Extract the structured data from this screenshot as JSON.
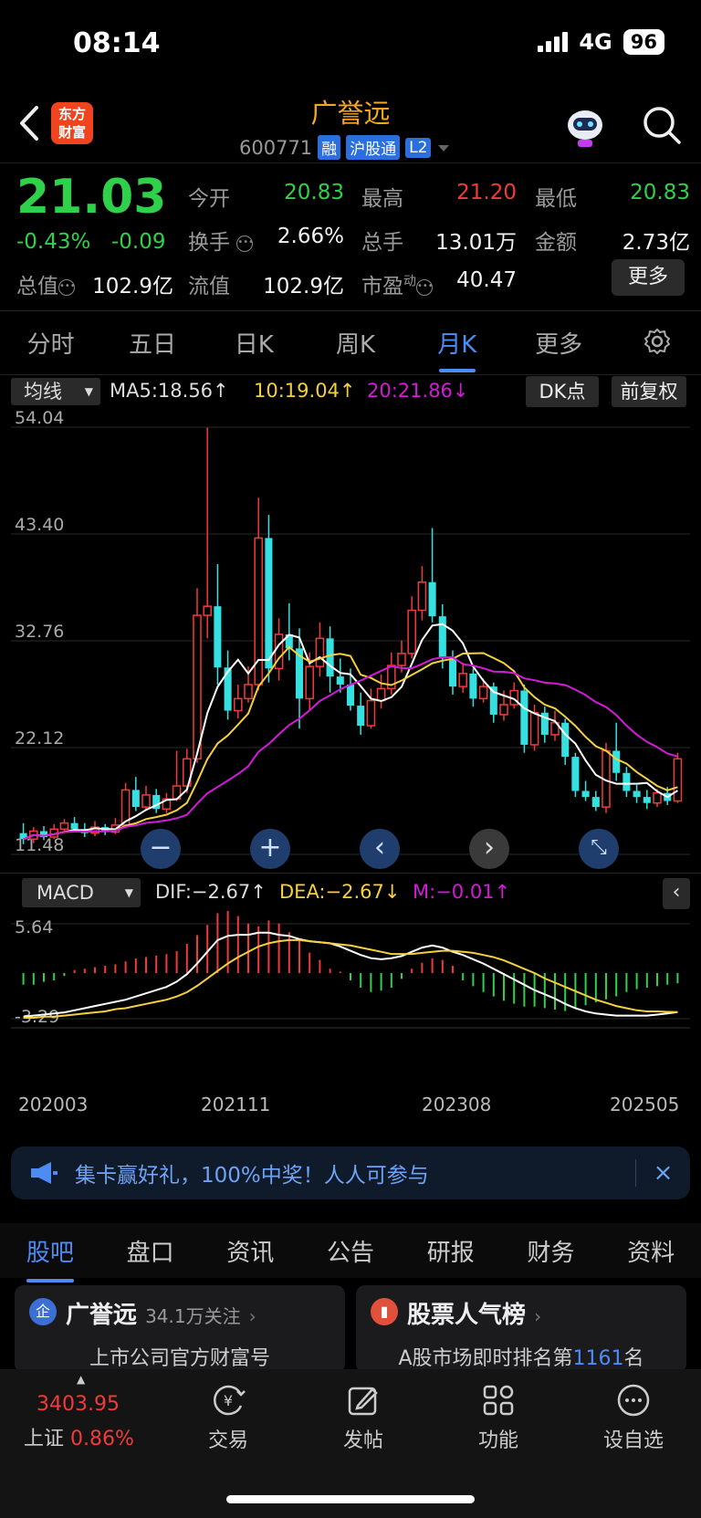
{
  "status": {
    "time": "08:14",
    "network": "4G",
    "battery": "96"
  },
  "header": {
    "logo_line1": "东方",
    "logo_line2": "财富",
    "name": "广誉远",
    "code": "600771",
    "tags": [
      "融",
      "沪股通",
      "L2"
    ]
  },
  "quote": {
    "price": "21.03",
    "change_pct": "-0.43%",
    "change_val": "-0.09",
    "open_label": "今开",
    "open": "20.83",
    "high_label": "最高",
    "high": "21.20",
    "low_label": "最低",
    "low": "20.83",
    "turnover_label": "换手",
    "turnover": "2.66%",
    "volume_label": "总手",
    "volume": "13.01万",
    "amount_label": "金额",
    "amount": "2.73亿",
    "mktcap_label": "总值",
    "mktcap": "102.9亿",
    "float_label": "流值",
    "float": "102.9亿",
    "pe_label": "市盈",
    "pe_sup": "动",
    "pe": "40.47",
    "more_label": "更多"
  },
  "period_tabs": [
    "分时",
    "五日",
    "日K",
    "周K",
    "月K",
    "更多"
  ],
  "active_period": "月K",
  "ma": {
    "select": "均线",
    "ma5": "MA5:18.56↑",
    "ma10": "10:19.04↑",
    "ma20": "20:21.86↓",
    "dk": "DK点",
    "adjust": "前复权"
  },
  "chart_data": [
    {
      "type": "candlestick",
      "title": "",
      "y_ticks": [
        "54.04",
        "43.40",
        "32.76",
        "22.12",
        "11.48"
      ],
      "ylim": [
        11.48,
        54.04
      ],
      "series": [
        {
          "name": "MA5",
          "color": "#ffffff",
          "last": 18.56
        },
        {
          "name": "10",
          "color": "#f4d03f",
          "last": 19.04
        },
        {
          "name": "20",
          "color": "#d21bd6",
          "last": 21.86
        }
      ],
      "x_ticks": [
        "202003",
        "202111",
        "202308",
        "202505"
      ],
      "candles": [
        [
          13.6,
          13.0,
          14.6,
          12.5
        ],
        [
          13.0,
          13.8,
          14.2,
          12.6
        ],
        [
          13.8,
          13.2,
          14.3,
          12.9
        ],
        [
          13.2,
          14.0,
          14.5,
          13.0
        ],
        [
          14.0,
          14.6,
          15.0,
          13.6
        ],
        [
          14.6,
          14.0,
          15.2,
          13.8
        ],
        [
          14.0,
          13.6,
          14.6,
          13.2
        ],
        [
          13.6,
          14.2,
          14.8,
          13.3
        ],
        [
          14.2,
          13.7,
          14.5,
          13.4
        ],
        [
          13.7,
          14.4,
          15.1,
          13.5
        ],
        [
          14.4,
          17.9,
          18.6,
          14.1
        ],
        [
          17.9,
          16.2,
          19.2,
          15.8
        ],
        [
          16.2,
          17.4,
          18.3,
          15.8
        ],
        [
          17.4,
          16.0,
          18.0,
          15.6
        ],
        [
          16.0,
          17.0,
          17.6,
          15.6
        ],
        [
          17.0,
          18.3,
          21.8,
          16.8
        ],
        [
          18.3,
          21.0,
          22.0,
          17.6
        ],
        [
          21.0,
          35.3,
          38.0,
          20.6
        ],
        [
          35.3,
          36.2,
          54.0,
          33.0
        ],
        [
          36.2,
          30.1,
          40.4,
          28.4
        ],
        [
          30.1,
          25.8,
          31.8,
          24.9
        ],
        [
          25.8,
          27.0,
          28.4,
          25.0
        ],
        [
          27.0,
          28.4,
          30.2,
          26.6
        ],
        [
          28.4,
          43.0,
          47.0,
          27.8
        ],
        [
          43.0,
          30.0,
          45.3,
          28.6
        ],
        [
          30.0,
          33.4,
          35.0,
          28.8
        ],
        [
          33.4,
          32.0,
          36.5,
          30.8
        ],
        [
          32.0,
          27.0,
          34.0,
          24.0
        ],
        [
          27.0,
          30.2,
          31.6,
          25.8
        ],
        [
          30.2,
          33.0,
          34.6,
          29.2
        ],
        [
          33.0,
          29.2,
          34.2,
          27.6
        ],
        [
          29.2,
          28.4,
          31.0,
          27.6
        ],
        [
          28.4,
          26.3,
          30.0,
          25.8
        ],
        [
          26.3,
          24.3,
          27.6,
          23.4
        ],
        [
          24.3,
          26.8,
          28.0,
          24.0
        ],
        [
          26.8,
          28.0,
          29.4,
          26.0
        ],
        [
          28.0,
          30.3,
          31.6,
          27.4
        ],
        [
          30.3,
          31.5,
          32.8,
          29.6
        ],
        [
          31.5,
          35.8,
          37.2,
          31.0
        ],
        [
          35.8,
          38.6,
          40.2,
          34.8
        ],
        [
          38.6,
          35.2,
          44.0,
          34.6
        ],
        [
          35.2,
          31.0,
          36.4,
          30.0
        ],
        [
          31.0,
          28.2,
          31.8,
          27.4
        ],
        [
          28.2,
          29.5,
          30.6,
          27.6
        ],
        [
          29.5,
          27.0,
          30.0,
          26.2
        ],
        [
          27.0,
          28.2,
          29.0,
          26.6
        ],
        [
          28.2,
          25.4,
          28.6,
          24.6
        ],
        [
          25.4,
          26.4,
          27.8,
          24.8
        ],
        [
          26.4,
          27.8,
          28.6,
          26.0
        ],
        [
          27.8,
          22.4,
          28.4,
          21.6
        ],
        [
          22.4,
          25.6,
          26.4,
          21.8
        ],
        [
          25.6,
          23.4,
          26.2,
          22.6
        ],
        [
          23.4,
          24.6,
          25.8,
          22.8
        ],
        [
          24.6,
          21.2,
          25.0,
          20.4
        ],
        [
          21.2,
          17.8,
          21.6,
          17.2
        ],
        [
          17.8,
          17.2,
          18.8,
          16.8
        ],
        [
          17.2,
          16.2,
          17.8,
          15.8
        ],
        [
          16.2,
          21.8,
          22.6,
          15.6
        ],
        [
          21.8,
          19.6,
          24.6,
          18.8
        ],
        [
          19.6,
          17.8,
          20.2,
          17.2
        ],
        [
          17.8,
          17.2,
          18.4,
          16.6
        ],
        [
          17.2,
          16.6,
          17.9,
          16.0
        ],
        [
          16.6,
          17.6,
          18.0,
          16.2
        ],
        [
          17.6,
          16.8,
          18.2,
          16.4
        ],
        [
          16.8,
          21.0,
          21.6,
          16.6
        ]
      ]
    },
    {
      "type": "bar",
      "title": "",
      "y_ticks": [
        "5.64",
        "-3.29"
      ],
      "ylim": [
        -3.29,
        5.64
      ],
      "series": [
        {
          "name": "DIF",
          "color": "#ffffff",
          "last": -2.67
        },
        {
          "name": "DEA",
          "color": "#f4d03f",
          "last": -2.67
        },
        {
          "name": "M",
          "color": "#d21bd6",
          "last": -0.01
        }
      ],
      "macd_bars": [
        -0.8,
        -0.8,
        -0.6,
        -0.5,
        -0.2,
        0.2,
        0.3,
        0.4,
        0.5,
        0.6,
        0.8,
        1.0,
        1.1,
        1.2,
        1.3,
        1.5,
        2.0,
        2.6,
        3.3,
        4.1,
        4.6,
        3.9,
        3.4,
        3.2,
        3.6,
        3.4,
        2.8,
        2.2,
        1.4,
        0.9,
        0.3,
        0.1,
        -0.5,
        -1.0,
        -1.3,
        -1.2,
        -1.0,
        -0.4,
        0.3,
        0.7,
        1.0,
        0.9,
        0.5,
        -0.5,
        -0.9,
        -1.3,
        -1.6,
        -1.9,
        -2.1,
        -2.3,
        -2.3,
        -2.4,
        -2.5,
        -2.6,
        -2.4,
        -2.2,
        -2.0,
        -1.8,
        -1.6,
        -1.3,
        -1.1,
        -1.0,
        -0.9,
        -0.8,
        -0.7
      ],
      "dif": [
        -3.1,
        -3.0,
        -2.9,
        -2.8,
        -2.7,
        -2.5,
        -2.3,
        -2.1,
        -1.9,
        -1.7,
        -1.5,
        -1.2,
        -0.9,
        -0.6,
        -0.3,
        0.2,
        0.9,
        1.9,
        3.0,
        4.1,
        4.5,
        4.6,
        4.6,
        4.8,
        4.8,
        4.6,
        4.5,
        4.2,
        4.0,
        3.9,
        3.8,
        3.5,
        3.1,
        2.7,
        2.4,
        2.3,
        2.4,
        2.6,
        3.0,
        3.4,
        3.6,
        3.4,
        3.0,
        2.7,
        2.3,
        1.9,
        1.4,
        0.9,
        0.4,
        -0.1,
        -0.6,
        -1.0,
        -1.4,
        -1.9,
        -2.3,
        -2.6,
        -2.8,
        -2.9,
        -3.0,
        -3.0,
        -3.0,
        -3.0,
        -2.9,
        -2.8,
        -2.67
      ],
      "dea": [
        -3.2,
        -3.2,
        -3.1,
        -3.1,
        -3.0,
        -2.9,
        -2.8,
        -2.7,
        -2.6,
        -2.4,
        -2.3,
        -2.1,
        -1.9,
        -1.7,
        -1.5,
        -1.2,
        -0.8,
        -0.2,
        0.5,
        1.2,
        1.9,
        2.5,
        3.0,
        3.5,
        3.8,
        4.0,
        4.1,
        4.1,
        4.0,
        3.9,
        3.8,
        3.7,
        3.6,
        3.4,
        3.2,
        3.0,
        2.8,
        2.8,
        2.8,
        2.9,
        3.0,
        3.1,
        3.1,
        3.0,
        2.9,
        2.7,
        2.5,
        2.2,
        1.8,
        1.4,
        1.0,
        0.5,
        0.1,
        -0.3,
        -0.7,
        -1.1,
        -1.5,
        -1.8,
        -2.1,
        -2.3,
        -2.5,
        -2.6,
        -2.6,
        -2.65,
        -2.67
      ]
    }
  ],
  "macd": {
    "select": "MACD",
    "dif": "DIF:−2.67↑",
    "dea": "DEA:−2.67↓",
    "m": "M:−0.01↑"
  },
  "banner": {
    "text": "集卡赢好礼，100%中奖！人人可参与",
    "close": "×"
  },
  "section_tabs": [
    "股吧",
    "盘口",
    "资讯",
    "公告",
    "研报",
    "财务",
    "资料"
  ],
  "active_section": "股吧",
  "cards": {
    "company": {
      "icon": "企",
      "title": "广誉远",
      "followers": "34.1万关注",
      "sub": "上市公司官方财富号"
    },
    "rank": {
      "title": "股票人气榜",
      "sub_prefix": "A股市场即时排名第",
      "rank": "1161",
      "sub_suffix": "名"
    }
  },
  "bottom_nav": {
    "index_value": "3403.95",
    "index_name": "上证",
    "index_pct": "0.86%",
    "items": [
      "交易",
      "发帖",
      "功能",
      "设自选"
    ]
  },
  "colors": {
    "up": "#f33a3a",
    "down": "#2fd14b",
    "accent": "#4d8cf5",
    "brand": "#f5a623"
  }
}
